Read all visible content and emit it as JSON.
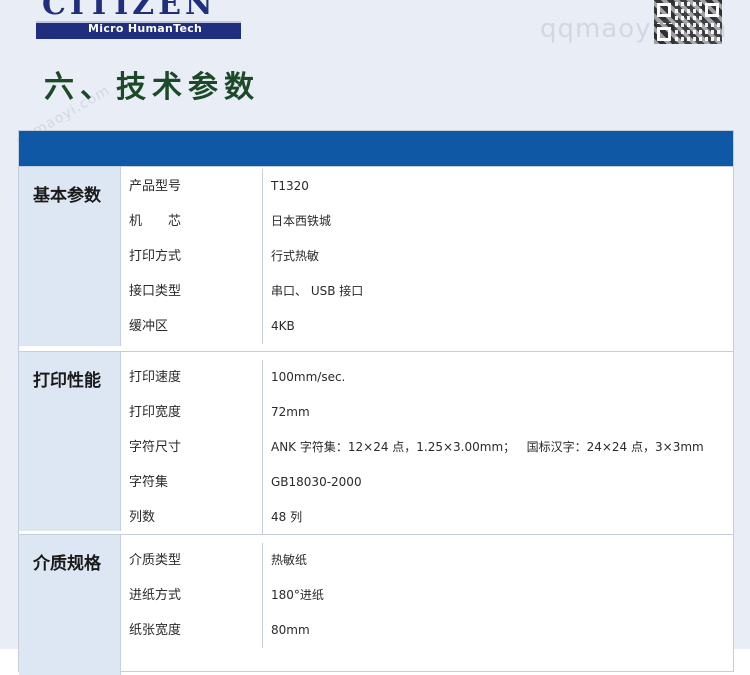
{
  "brand": {
    "name": "CITIZEN",
    "tagline": "Micro HumanTech"
  },
  "watermark": "qqmaoyi.com",
  "page_title": "六、技术参数",
  "sections": [
    {
      "label": "基本参数",
      "rows": [
        {
          "param": "产品型号",
          "value": "T1320"
        },
        {
          "param": "机　　芯",
          "value": "日本西铁城"
        },
        {
          "param": "打印方式",
          "value": "行式热敏"
        },
        {
          "param": "接口类型",
          "value": "串口、 USB 接口"
        },
        {
          "param": "缓冲区",
          "value": "4KB"
        }
      ]
    },
    {
      "label": "打印性能",
      "rows": [
        {
          "param": "打印速度",
          "value": "100mm/sec."
        },
        {
          "param": "打印宽度",
          "value": "72mm"
        },
        {
          "param": "字符尺寸",
          "value": "ANK 字符集：12×24 点，1.25×3.00mm；   国标汉字：24×24 点，3×3mm"
        },
        {
          "param": "字符集",
          "value": "GB18030-2000"
        },
        {
          "param": "列数",
          "value": "48 列"
        }
      ]
    },
    {
      "label": "介质规格",
      "rows": [
        {
          "param": "介质类型",
          "value": "热敏纸"
        },
        {
          "param": "进纸方式",
          "value": "180°进纸"
        },
        {
          "param": "纸张宽度",
          "value": "80mm"
        }
      ]
    }
  ],
  "colors": {
    "brand_navy": "#1f2f7d",
    "table_header": "#0f58a6",
    "section_bg": "#dde6f3",
    "heading_green": "#1c4a28"
  }
}
